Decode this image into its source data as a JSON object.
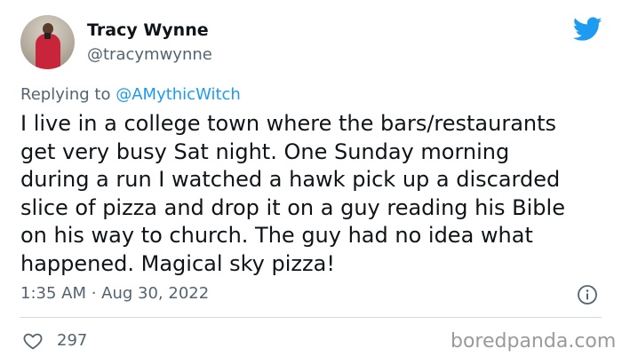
{
  "author": {
    "display_name": "Tracy Wynne",
    "handle": "@tracymwynne"
  },
  "reply": {
    "prefix": "Replying to",
    "mention": "@AMythicWitch"
  },
  "tweet": {
    "lines": [
      "I live in a college town where the bars/restaurants",
      "get very busy Sat night. One Sunday morning",
      "during a run I watched a hawk pick up a discarded",
      "slice of pizza and drop it on a guy reading his Bible",
      "on his way to church. The guy had no idea what",
      "happened. Magical sky pizza!"
    ],
    "timestamp": "1:35 AM · Aug 30, 2022"
  },
  "engagement": {
    "likes": "297"
  },
  "watermark": "boredpanda.com",
  "icons": {
    "logo": "twitter-bird-icon",
    "info": "info-icon",
    "like": "heart-icon"
  },
  "colors": {
    "text": "#0f1419",
    "secondary": "#536471",
    "accent": "#1d9bf0",
    "divider": "#cfd9de",
    "watermark": "#9a9a9a"
  }
}
